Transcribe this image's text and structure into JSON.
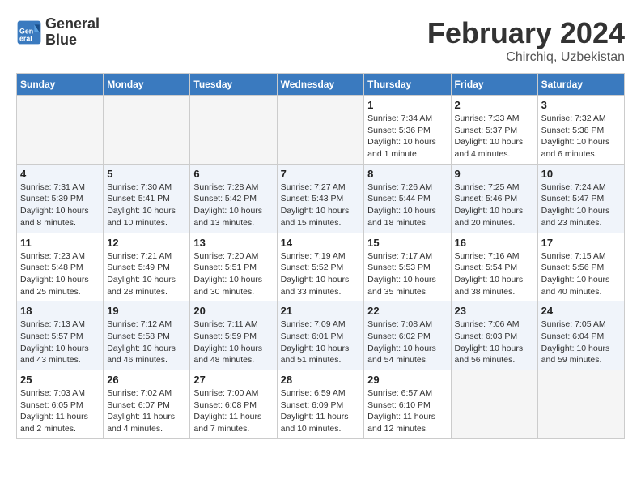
{
  "header": {
    "logo_line1": "General",
    "logo_line2": "Blue",
    "month_year": "February 2024",
    "location": "Chirchiq, Uzbekistan"
  },
  "days_of_week": [
    "Sunday",
    "Monday",
    "Tuesday",
    "Wednesday",
    "Thursday",
    "Friday",
    "Saturday"
  ],
  "weeks": [
    [
      {
        "day": "",
        "sunrise": "",
        "sunset": "",
        "daylight": "",
        "empty": true
      },
      {
        "day": "",
        "sunrise": "",
        "sunset": "",
        "daylight": "",
        "empty": true
      },
      {
        "day": "",
        "sunrise": "",
        "sunset": "",
        "daylight": "",
        "empty": true
      },
      {
        "day": "",
        "sunrise": "",
        "sunset": "",
        "daylight": "",
        "empty": true
      },
      {
        "day": "1",
        "sunrise": "Sunrise: 7:34 AM",
        "sunset": "Sunset: 5:36 PM",
        "daylight": "Daylight: 10 hours and 1 minute.",
        "empty": false
      },
      {
        "day": "2",
        "sunrise": "Sunrise: 7:33 AM",
        "sunset": "Sunset: 5:37 PM",
        "daylight": "Daylight: 10 hours and 4 minutes.",
        "empty": false
      },
      {
        "day": "3",
        "sunrise": "Sunrise: 7:32 AM",
        "sunset": "Sunset: 5:38 PM",
        "daylight": "Daylight: 10 hours and 6 minutes.",
        "empty": false
      }
    ],
    [
      {
        "day": "4",
        "sunrise": "Sunrise: 7:31 AM",
        "sunset": "Sunset: 5:39 PM",
        "daylight": "Daylight: 10 hours and 8 minutes.",
        "empty": false
      },
      {
        "day": "5",
        "sunrise": "Sunrise: 7:30 AM",
        "sunset": "Sunset: 5:41 PM",
        "daylight": "Daylight: 10 hours and 10 minutes.",
        "empty": false
      },
      {
        "day": "6",
        "sunrise": "Sunrise: 7:28 AM",
        "sunset": "Sunset: 5:42 PM",
        "daylight": "Daylight: 10 hours and 13 minutes.",
        "empty": false
      },
      {
        "day": "7",
        "sunrise": "Sunrise: 7:27 AM",
        "sunset": "Sunset: 5:43 PM",
        "daylight": "Daylight: 10 hours and 15 minutes.",
        "empty": false
      },
      {
        "day": "8",
        "sunrise": "Sunrise: 7:26 AM",
        "sunset": "Sunset: 5:44 PM",
        "daylight": "Daylight: 10 hours and 18 minutes.",
        "empty": false
      },
      {
        "day": "9",
        "sunrise": "Sunrise: 7:25 AM",
        "sunset": "Sunset: 5:46 PM",
        "daylight": "Daylight: 10 hours and 20 minutes.",
        "empty": false
      },
      {
        "day": "10",
        "sunrise": "Sunrise: 7:24 AM",
        "sunset": "Sunset: 5:47 PM",
        "daylight": "Daylight: 10 hours and 23 minutes.",
        "empty": false
      }
    ],
    [
      {
        "day": "11",
        "sunrise": "Sunrise: 7:23 AM",
        "sunset": "Sunset: 5:48 PM",
        "daylight": "Daylight: 10 hours and 25 minutes.",
        "empty": false
      },
      {
        "day": "12",
        "sunrise": "Sunrise: 7:21 AM",
        "sunset": "Sunset: 5:49 PM",
        "daylight": "Daylight: 10 hours and 28 minutes.",
        "empty": false
      },
      {
        "day": "13",
        "sunrise": "Sunrise: 7:20 AM",
        "sunset": "Sunset: 5:51 PM",
        "daylight": "Daylight: 10 hours and 30 minutes.",
        "empty": false
      },
      {
        "day": "14",
        "sunrise": "Sunrise: 7:19 AM",
        "sunset": "Sunset: 5:52 PM",
        "daylight": "Daylight: 10 hours and 33 minutes.",
        "empty": false
      },
      {
        "day": "15",
        "sunrise": "Sunrise: 7:17 AM",
        "sunset": "Sunset: 5:53 PM",
        "daylight": "Daylight: 10 hours and 35 minutes.",
        "empty": false
      },
      {
        "day": "16",
        "sunrise": "Sunrise: 7:16 AM",
        "sunset": "Sunset: 5:54 PM",
        "daylight": "Daylight: 10 hours and 38 minutes.",
        "empty": false
      },
      {
        "day": "17",
        "sunrise": "Sunrise: 7:15 AM",
        "sunset": "Sunset: 5:56 PM",
        "daylight": "Daylight: 10 hours and 40 minutes.",
        "empty": false
      }
    ],
    [
      {
        "day": "18",
        "sunrise": "Sunrise: 7:13 AM",
        "sunset": "Sunset: 5:57 PM",
        "daylight": "Daylight: 10 hours and 43 minutes.",
        "empty": false
      },
      {
        "day": "19",
        "sunrise": "Sunrise: 7:12 AM",
        "sunset": "Sunset: 5:58 PM",
        "daylight": "Daylight: 10 hours and 46 minutes.",
        "empty": false
      },
      {
        "day": "20",
        "sunrise": "Sunrise: 7:11 AM",
        "sunset": "Sunset: 5:59 PM",
        "daylight": "Daylight: 10 hours and 48 minutes.",
        "empty": false
      },
      {
        "day": "21",
        "sunrise": "Sunrise: 7:09 AM",
        "sunset": "Sunset: 6:01 PM",
        "daylight": "Daylight: 10 hours and 51 minutes.",
        "empty": false
      },
      {
        "day": "22",
        "sunrise": "Sunrise: 7:08 AM",
        "sunset": "Sunset: 6:02 PM",
        "daylight": "Daylight: 10 hours and 54 minutes.",
        "empty": false
      },
      {
        "day": "23",
        "sunrise": "Sunrise: 7:06 AM",
        "sunset": "Sunset: 6:03 PM",
        "daylight": "Daylight: 10 hours and 56 minutes.",
        "empty": false
      },
      {
        "day": "24",
        "sunrise": "Sunrise: 7:05 AM",
        "sunset": "Sunset: 6:04 PM",
        "daylight": "Daylight: 10 hours and 59 minutes.",
        "empty": false
      }
    ],
    [
      {
        "day": "25",
        "sunrise": "Sunrise: 7:03 AM",
        "sunset": "Sunset: 6:05 PM",
        "daylight": "Daylight: 11 hours and 2 minutes.",
        "empty": false
      },
      {
        "day": "26",
        "sunrise": "Sunrise: 7:02 AM",
        "sunset": "Sunset: 6:07 PM",
        "daylight": "Daylight: 11 hours and 4 minutes.",
        "empty": false
      },
      {
        "day": "27",
        "sunrise": "Sunrise: 7:00 AM",
        "sunset": "Sunset: 6:08 PM",
        "daylight": "Daylight: 11 hours and 7 minutes.",
        "empty": false
      },
      {
        "day": "28",
        "sunrise": "Sunrise: 6:59 AM",
        "sunset": "Sunset: 6:09 PM",
        "daylight": "Daylight: 11 hours and 10 minutes.",
        "empty": false
      },
      {
        "day": "29",
        "sunrise": "Sunrise: 6:57 AM",
        "sunset": "Sunset: 6:10 PM",
        "daylight": "Daylight: 11 hours and 12 minutes.",
        "empty": false
      },
      {
        "day": "",
        "sunrise": "",
        "sunset": "",
        "daylight": "",
        "empty": true
      },
      {
        "day": "",
        "sunrise": "",
        "sunset": "",
        "daylight": "",
        "empty": true
      }
    ]
  ]
}
